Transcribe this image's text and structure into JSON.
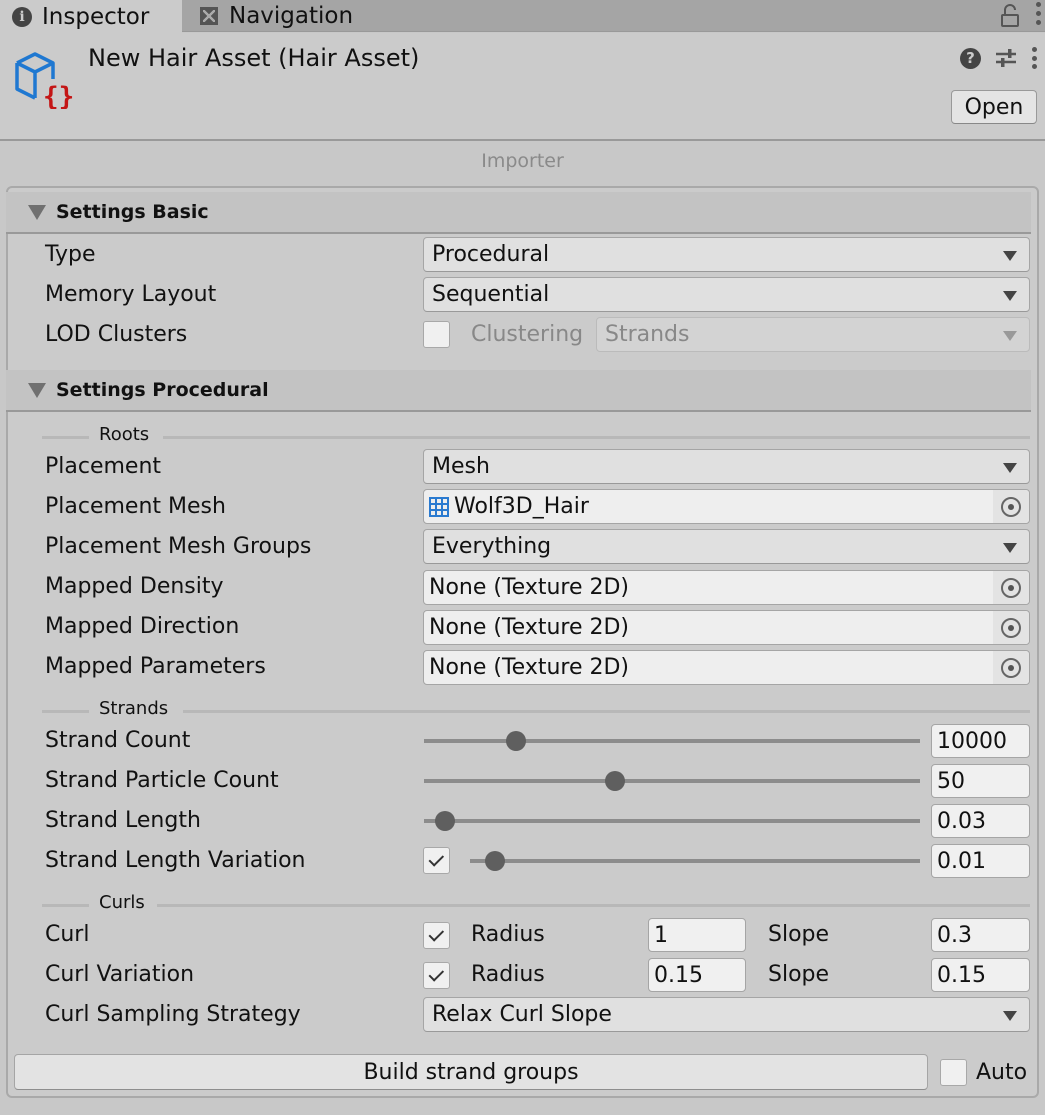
{
  "tabs": [
    {
      "label": "Inspector",
      "icon": "info-icon",
      "active": true
    },
    {
      "label": "Navigation",
      "icon": "navigation-icon",
      "active": false
    }
  ],
  "header": {
    "title": "New Hair Asset (Hair Asset)",
    "open_label": "Open",
    "icons": [
      "help-icon",
      "presets-icon",
      "kebab-menu-icon"
    ]
  },
  "importer_label": "Importer",
  "sections": {
    "basic": {
      "title": "Settings Basic",
      "type": {
        "label": "Type",
        "value": "Procedural"
      },
      "memory_layout": {
        "label": "Memory Layout",
        "value": "Sequential"
      },
      "lod_clusters": {
        "label": "LOD Clusters",
        "checked": false,
        "clustering_label": "Clustering",
        "clustering_value": "Strands"
      }
    },
    "procedural": {
      "title": "Settings Procedural",
      "roots": {
        "group_label": "Roots",
        "placement": {
          "label": "Placement",
          "value": "Mesh"
        },
        "placement_mesh": {
          "label": "Placement Mesh",
          "value": "Wolf3D_Hair"
        },
        "placement_mesh_groups": {
          "label": "Placement Mesh Groups",
          "value": "Everything"
        },
        "mapped_density": {
          "label": "Mapped Density",
          "value": "None (Texture 2D)"
        },
        "mapped_direction": {
          "label": "Mapped Direction",
          "value": "None (Texture 2D)"
        },
        "mapped_parameters": {
          "label": "Mapped Parameters",
          "value": "None (Texture 2D)"
        }
      },
      "strands": {
        "group_label": "Strands",
        "strand_count": {
          "label": "Strand Count",
          "value": "10000",
          "slider_fraction": 0.17
        },
        "strand_particle_count": {
          "label": "Strand Particle Count",
          "value": "50",
          "slider_fraction": 0.38
        },
        "strand_length": {
          "label": "Strand Length",
          "value": "0.03",
          "slider_fraction": 0.02
        },
        "strand_length_variation": {
          "label": "Strand Length Variation",
          "enabled": true,
          "value": "0.01",
          "slider_fraction": 0.03
        }
      },
      "curls": {
        "group_label": "Curls",
        "curl": {
          "label": "Curl",
          "enabled": true,
          "radius_label": "Radius",
          "radius": "1",
          "slope_label": "Slope",
          "slope": "0.3"
        },
        "curl_variation": {
          "label": "Curl Variation",
          "enabled": true,
          "radius_label": "Radius",
          "radius": "0.15",
          "slope_label": "Slope",
          "slope": "0.15"
        },
        "curl_sampling_strategy": {
          "label": "Curl Sampling Strategy",
          "value": "Relax Curl Slope"
        }
      }
    }
  },
  "footer": {
    "build_label": "Build strand groups",
    "auto_label": "Auto",
    "auto_checked": false
  },
  "colors": {
    "asset_icon_blue": "#1f78d1",
    "asset_icon_red": "#c41616",
    "mesh_icon_blue": "#2a7ad0"
  }
}
